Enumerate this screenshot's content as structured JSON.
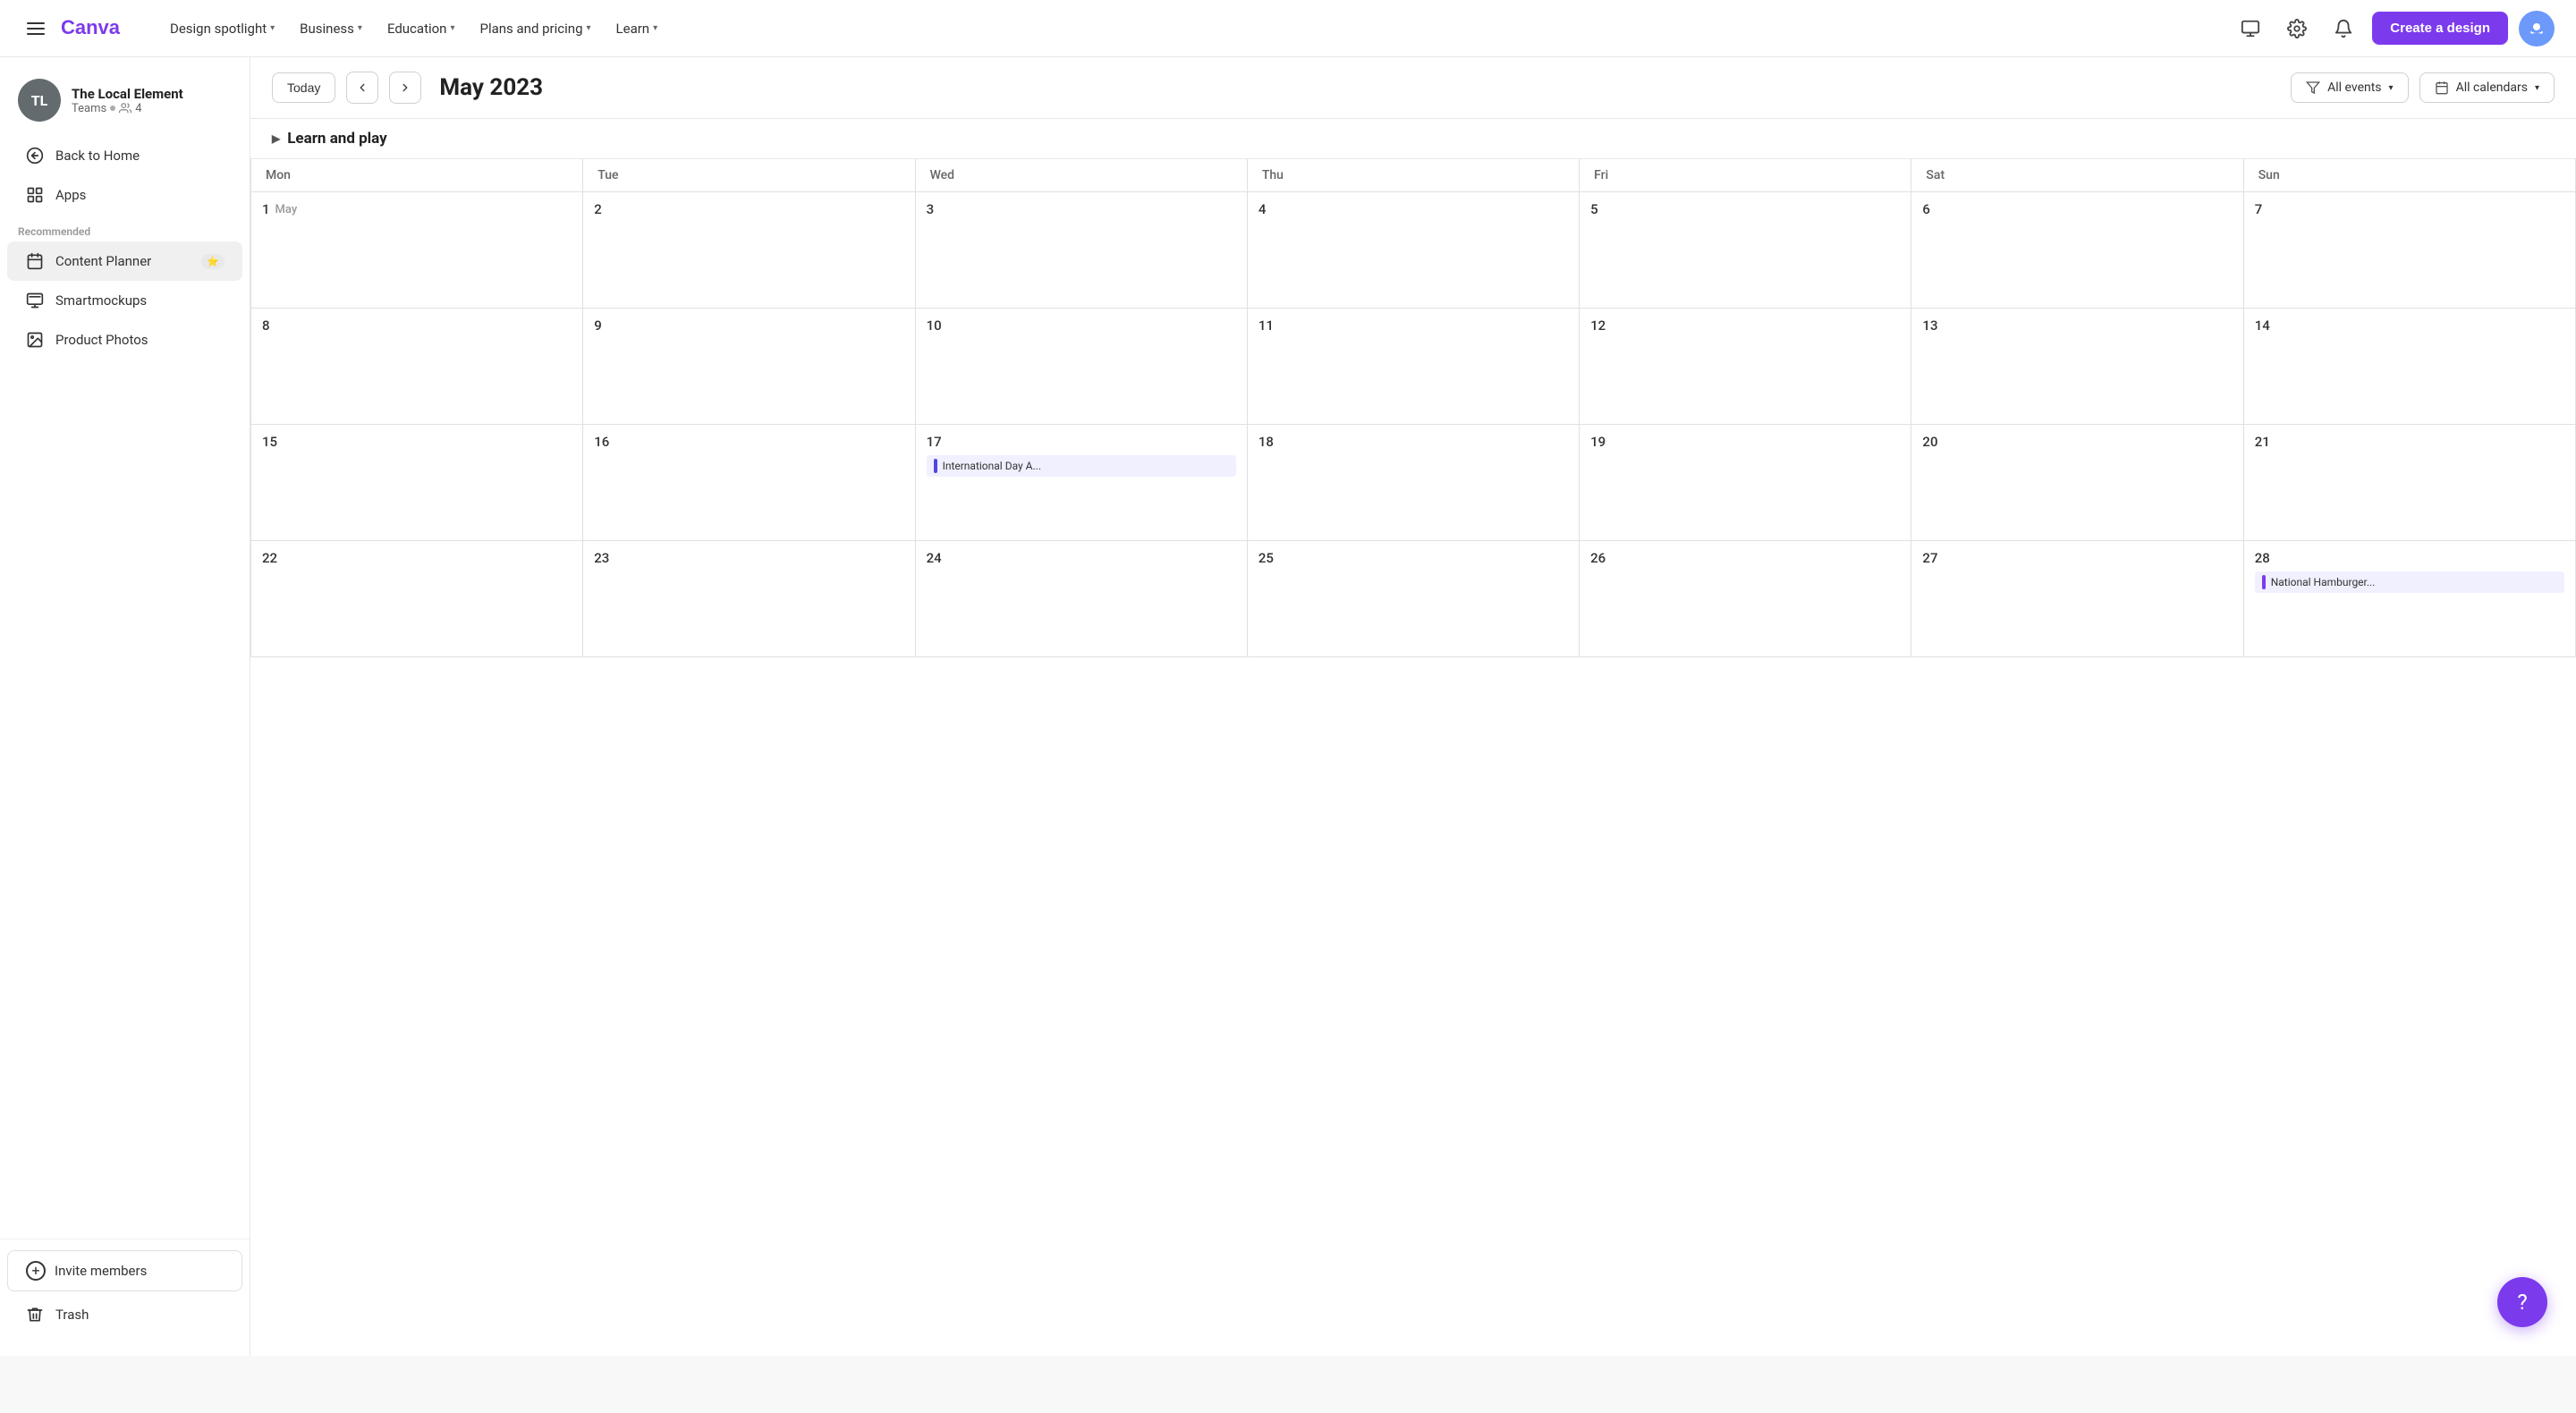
{
  "topnav": {
    "logo_alt": "Canva",
    "links": [
      {
        "label": "Design spotlight",
        "id": "design-spotlight"
      },
      {
        "label": "Business",
        "id": "business"
      },
      {
        "label": "Education",
        "id": "education"
      },
      {
        "label": "Plans and pricing",
        "id": "plans-pricing"
      },
      {
        "label": "Learn",
        "id": "learn"
      }
    ],
    "create_label": "Create a design"
  },
  "sidebar": {
    "user": {
      "initials": "TL",
      "name": "The Local Element",
      "team": "Teams",
      "member_count": "4"
    },
    "back_label": "Back to Home",
    "apps_label": "Apps",
    "recommended_label": "Recommended",
    "items": [
      {
        "label": "Content Planner",
        "active": true
      },
      {
        "label": "Smartmockups",
        "active": false
      },
      {
        "label": "Product Photos",
        "active": false
      }
    ],
    "invite_label": "Invite members",
    "trash_label": "Trash"
  },
  "calendar": {
    "today_label": "Today",
    "month_title": "May 2023",
    "filter_events_label": "All events",
    "filter_calendars_label": "All calendars",
    "section_label": "Learn and play",
    "days": [
      "Mon",
      "Tue",
      "Wed",
      "Thu",
      "Fri",
      "Sat",
      "Sun"
    ],
    "weeks": [
      [
        {
          "num": "1",
          "month": "May",
          "events": []
        },
        {
          "num": "2",
          "events": []
        },
        {
          "num": "3",
          "events": []
        },
        {
          "num": "4",
          "events": []
        },
        {
          "num": "5",
          "events": []
        },
        {
          "num": "6",
          "events": []
        },
        {
          "num": "7",
          "events": []
        }
      ],
      [
        {
          "num": "8",
          "events": []
        },
        {
          "num": "9",
          "events": []
        },
        {
          "num": "10",
          "events": []
        },
        {
          "num": "11",
          "events": []
        },
        {
          "num": "12",
          "events": []
        },
        {
          "num": "13",
          "events": []
        },
        {
          "num": "14",
          "events": []
        }
      ],
      [
        {
          "num": "15",
          "events": []
        },
        {
          "num": "16",
          "events": []
        },
        {
          "num": "17",
          "events": [
            {
              "text": "International Day A...",
              "color": "#4f46e5"
            }
          ]
        },
        {
          "num": "18",
          "events": []
        },
        {
          "num": "19",
          "events": []
        },
        {
          "num": "20",
          "events": []
        },
        {
          "num": "21",
          "events": []
        }
      ],
      [
        {
          "num": "22",
          "events": []
        },
        {
          "num": "23",
          "events": []
        },
        {
          "num": "24",
          "events": []
        },
        {
          "num": "25",
          "events": []
        },
        {
          "num": "26",
          "events": []
        },
        {
          "num": "27",
          "events": []
        },
        {
          "num": "28",
          "events": [
            {
              "text": "National Hamburger...",
              "color": "#7c3aed"
            }
          ]
        }
      ]
    ],
    "fab_label": "?"
  }
}
